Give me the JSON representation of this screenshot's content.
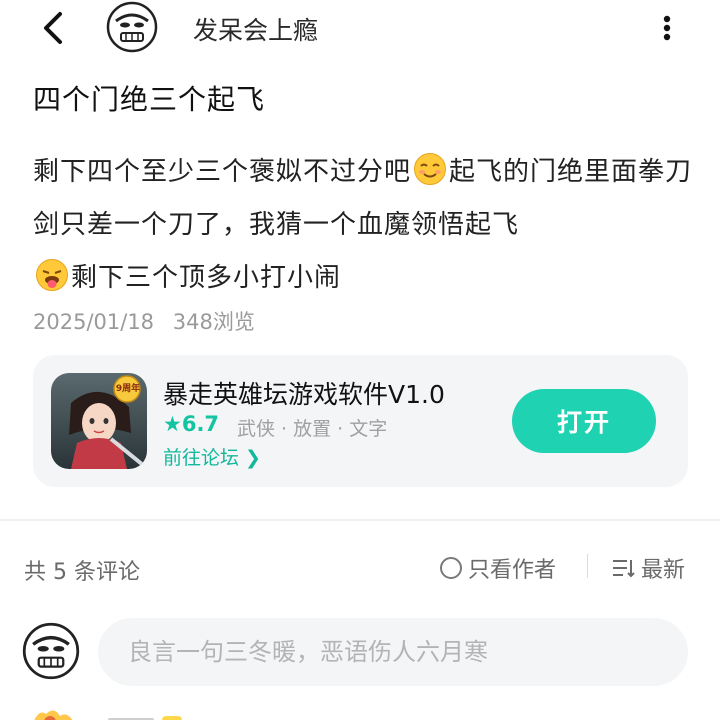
{
  "header": {
    "author_name": "发呆会上瘾",
    "back_icon": "chevron-left-icon",
    "more_icon": "vertical-dots-icon"
  },
  "post": {
    "title": "四个门绝三个起飞",
    "body_part1": "剩下四个至少三个褒姒不过分吧",
    "body_part2": "起飞的门绝里面拳刀剑只差一个刀了，我猜一个血魔领悟起飞",
    "body_part3": "剩下三个顶多小打小闹",
    "date": "2025/01/18",
    "views": "348浏览"
  },
  "game_card": {
    "name": "暴走英雄坛游戏软件V1.0",
    "rating": "★6.7",
    "tags": "武侠 · 放置 · 文字",
    "forum_link": "前往论坛 ❯",
    "open_label": "打开",
    "icon_badge": "9周年"
  },
  "comments": {
    "count_label": "共 5 条评论",
    "author_only_label": "只看作者",
    "sort_label": "最新",
    "input_placeholder": "良言一句三冬暖，恶语伤人六月寒"
  },
  "colors": {
    "accent": "#1fd2b1",
    "rating": "#12c4a2",
    "card_bg": "#f4f5f7",
    "meta_text": "#9a9a9a"
  }
}
